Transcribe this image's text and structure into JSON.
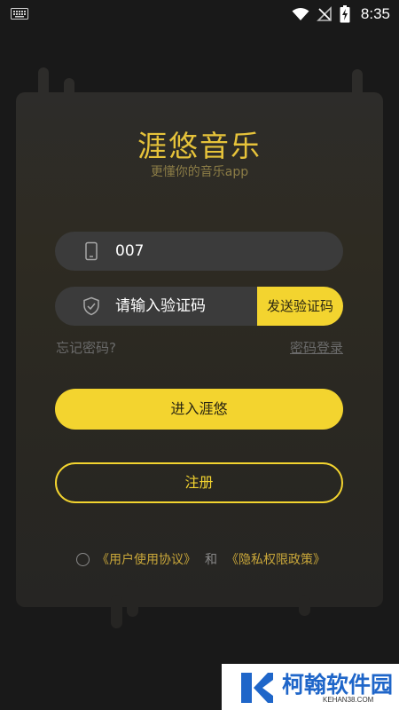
{
  "status_bar": {
    "time": "8:35",
    "icons": [
      "keyboard-icon",
      "wifi-icon",
      "no-signal-icon",
      "battery-charging-icon"
    ]
  },
  "app": {
    "title": "涯悠音乐",
    "subtitle": "更懂你的音乐app"
  },
  "login_form": {
    "phone_value": "007",
    "code_placeholder": "请输入验证码",
    "send_code_label": "发送验证码",
    "forgot_password_label": "忘记密码?",
    "password_login_label": "密码登录",
    "enter_label": "进入涯悠",
    "register_label": "注册"
  },
  "agreement": {
    "user_agreement_label": "《用户使用协议》",
    "and_label": "和",
    "privacy_policy_label": "《隐私权限政策》"
  },
  "watermark": {
    "brand": "柯翰软件园",
    "domain": "KEHAN38.COM"
  },
  "colors": {
    "accent": "#f3d42f",
    "title": "#e6c33a",
    "background": "#191919",
    "field": "#3b3b3b",
    "muted": "#6a6a6a"
  }
}
